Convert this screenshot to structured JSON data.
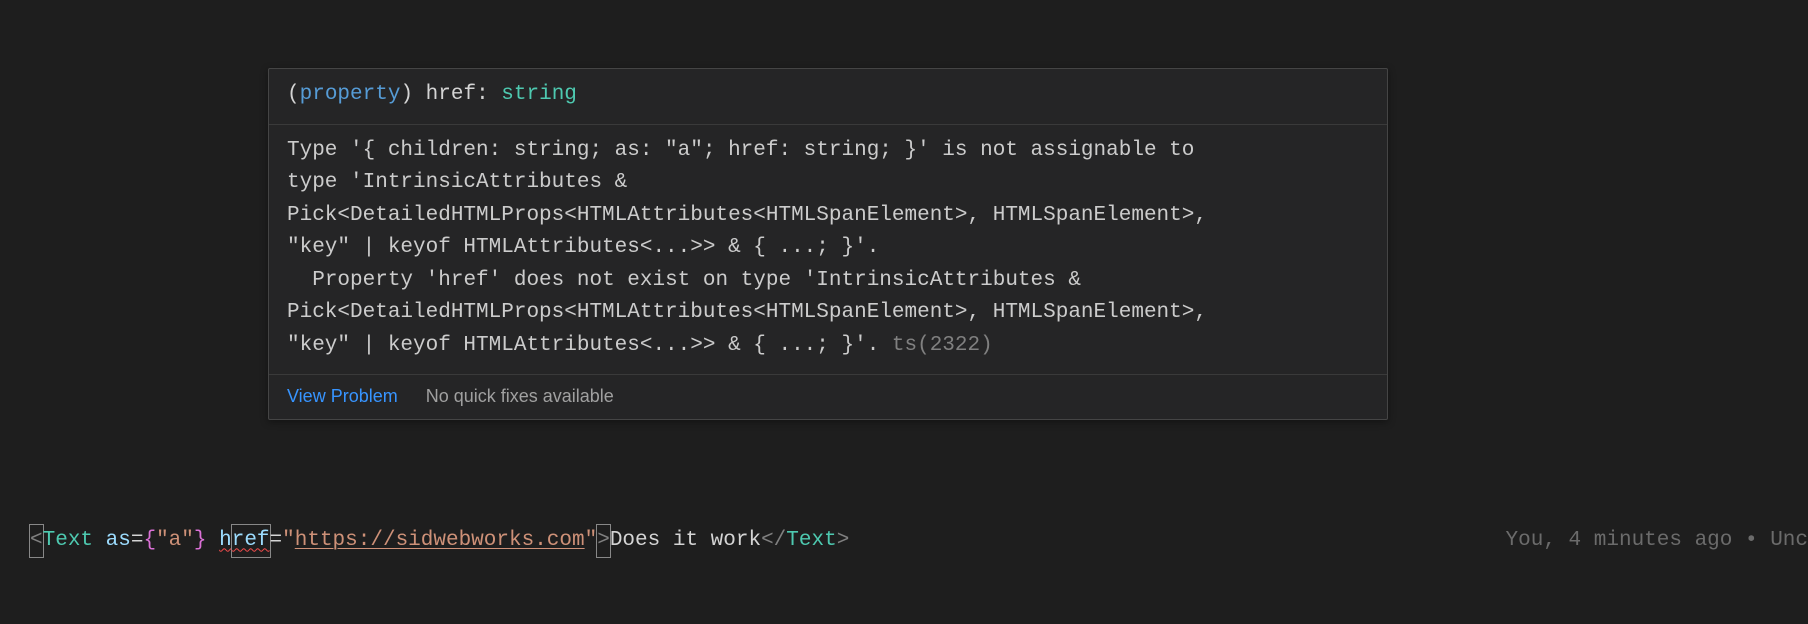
{
  "tooltip": {
    "signature": {
      "paren_open": "(",
      "keyword": "property",
      "paren_close": ")",
      "space": " ",
      "name": "href",
      "colon": ": ",
      "type": "string"
    },
    "error_message": "Type '{ children: string; as: \"a\"; href: string; }' is not assignable to\ntype 'IntrinsicAttributes &\nPick<DetailedHTMLProps<HTMLAttributes<HTMLSpanElement>, HTMLSpanElement>,\n\"key\" | keyof HTMLAttributes<...>> & { ...; }'.\n  Property 'href' does not exist on type 'IntrinsicAttributes &\nPick<DetailedHTMLProps<HTMLAttributes<HTMLSpanElement>, HTMLSpanElement>,\n\"key\" | keyof HTMLAttributes<...>> & { ...; }'.",
    "error_code_label": " ts(2322)",
    "footer": {
      "view_problem": "View Problem",
      "no_fixes": "No quick fixes available"
    }
  },
  "code": {
    "open_angle": "<",
    "component": "Text",
    "space1": " ",
    "attr_as": "as",
    "eq1": "=",
    "brace_open": "{",
    "as_value": "\"a\"",
    "brace_close": "}",
    "space2": " ",
    "attr_h": "h",
    "attr_ref": "ref",
    "eq2": "=",
    "quote_open": "\"",
    "url": "https://sidwebworks.com",
    "quote_close": "\"",
    "close_angle": ">",
    "inner_text": "Does it work",
    "close_open_angle": "<",
    "slash": "/",
    "close_component": "Text",
    "close_close_angle": ">"
  },
  "gitlens": {
    "text": "You, 4 minutes ago • Unc"
  }
}
